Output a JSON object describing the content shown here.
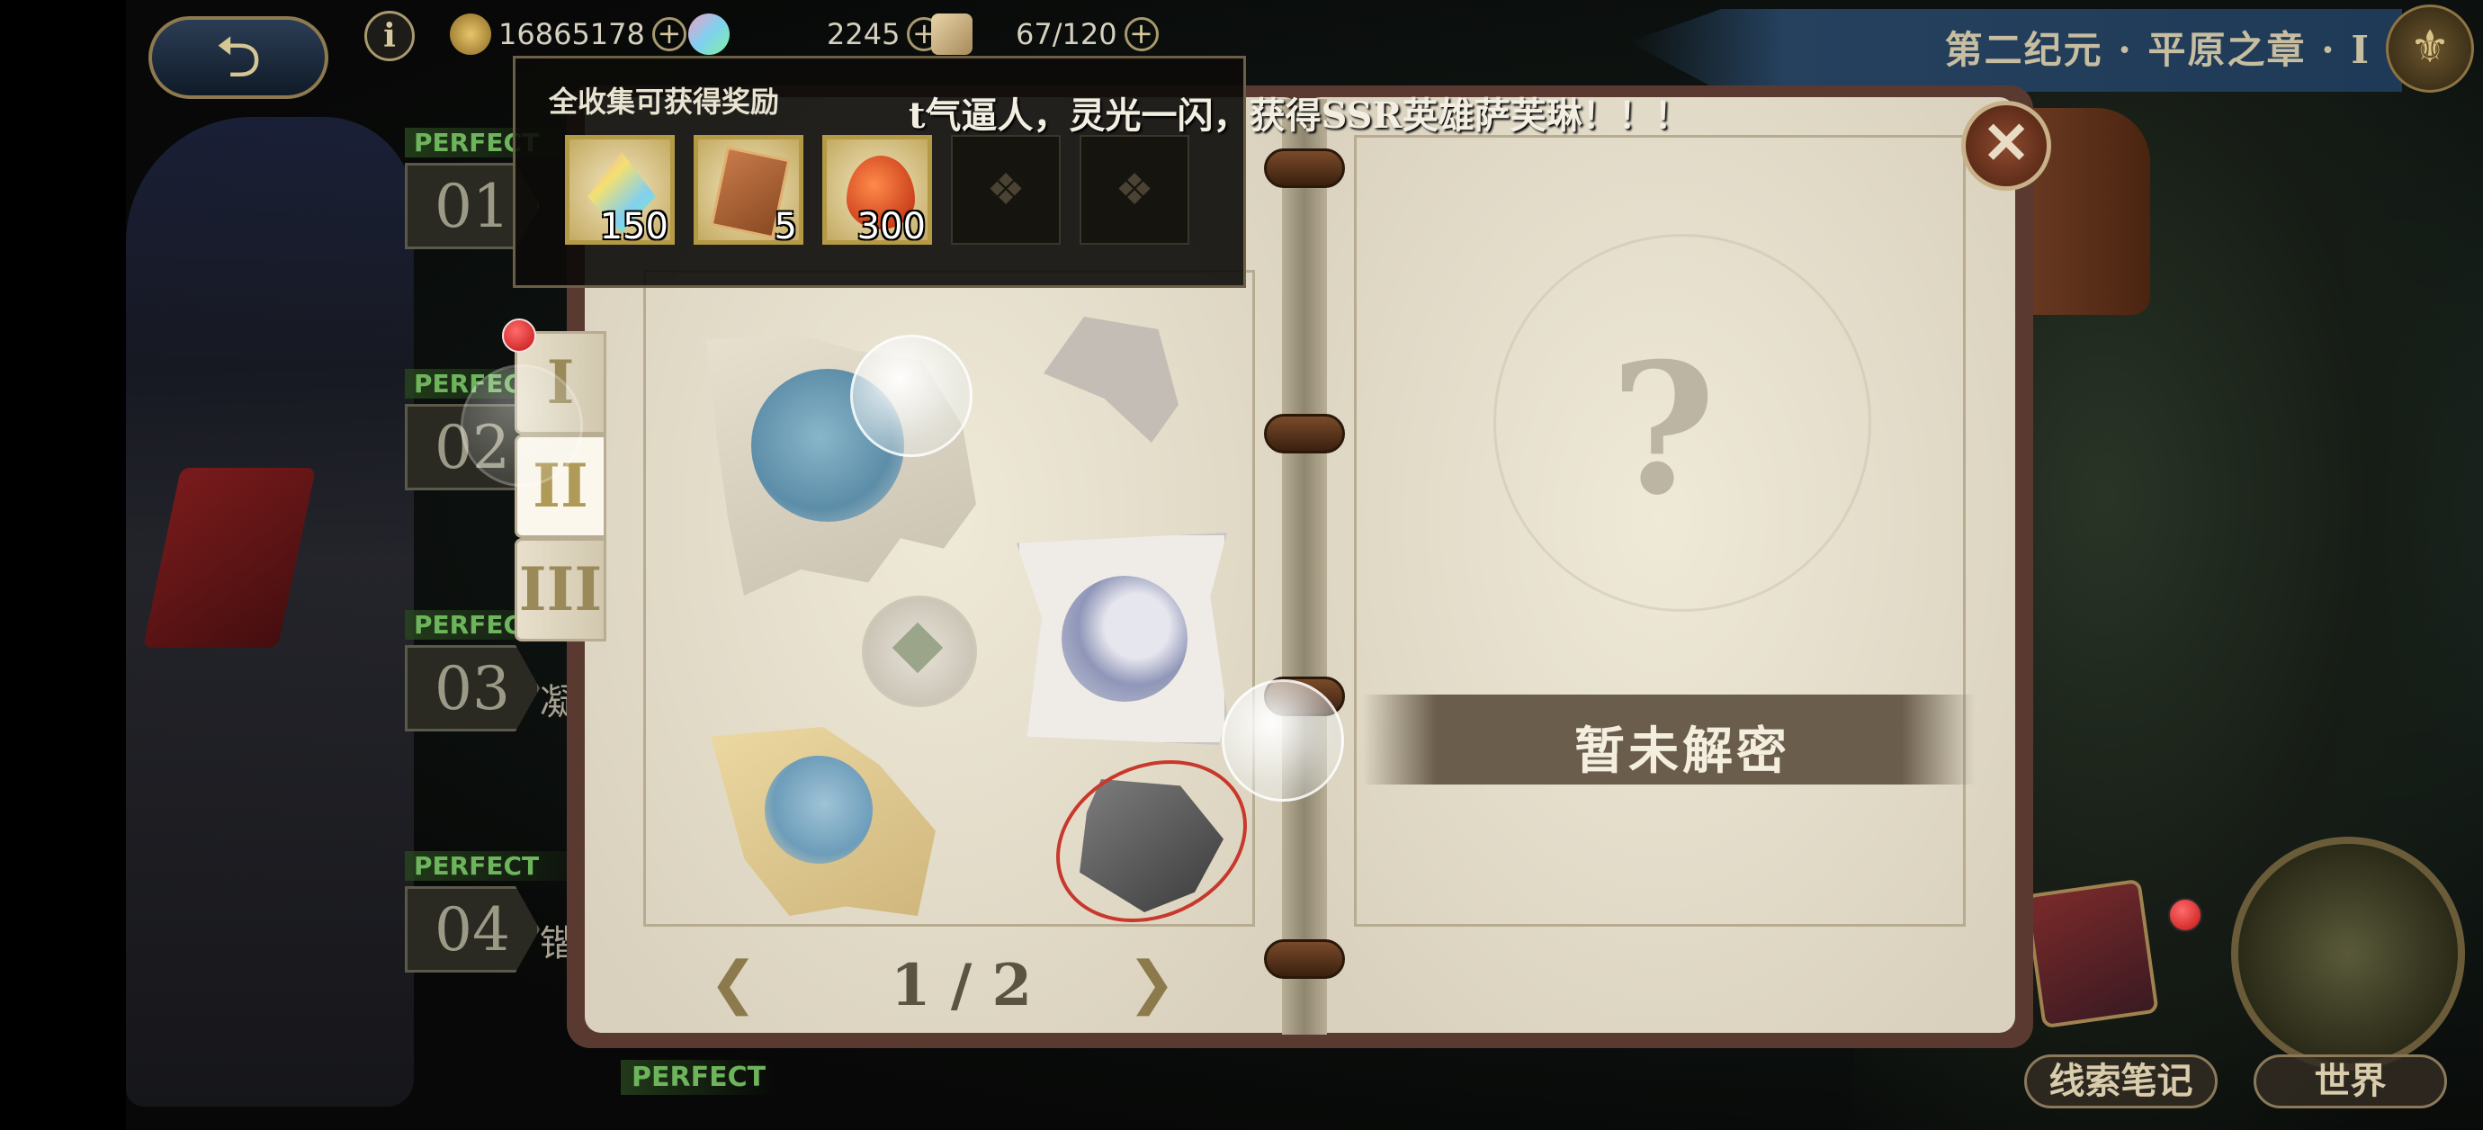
{
  "topbar": {
    "back_label": "⮌",
    "info_label": "i",
    "resources": [
      {
        "name": "gold",
        "value": "16865178",
        "icon": "coin-icon",
        "color": "#c9a24a"
      },
      {
        "name": "gems",
        "value": "2245",
        "icon": "gem-icon",
        "color": "#8fcfe0"
      },
      {
        "name": "stamina",
        "value": "67/120",
        "icon": "scroll-icon",
        "color": "#d8c39a"
      }
    ],
    "plus_label": "+",
    "chapter_title": "第二纪元 · 平原之章 · I"
  },
  "chapters": [
    {
      "perfect": "PERFECT",
      "number": "01",
      "extra": ""
    },
    {
      "perfect": "PERFECT",
      "number": "02",
      "extra": ""
    },
    {
      "perfect": "PERFECT",
      "number": "03",
      "extra": "凝"
    },
    {
      "perfect": "PERFECT",
      "number": "04",
      "extra": "锴"
    }
  ],
  "bottom_perfect": "PERFECT",
  "rewards": {
    "title": "全收集可获得奖励",
    "items": [
      {
        "icon": "rainbow-gem-icon",
        "count": "150"
      },
      {
        "icon": "ticket-icon",
        "count": "5"
      },
      {
        "icon": "red-seed-icon",
        "count": "300"
      }
    ],
    "empty_slots": 2
  },
  "marquee": "t气逼人，灵光一闪，获得SSR英雄萨芙琳！！！",
  "book": {
    "tabs": [
      "I",
      "II",
      "III"
    ],
    "active_tab": 1,
    "page_indicator": "1 / 2",
    "prev_label": "❮",
    "next_label": "❯",
    "locked_label": "暂未解密",
    "question_mark": "?"
  },
  "close_label": "✕",
  "bottom_buttons": {
    "notes": "线索笔记",
    "world": "世界"
  }
}
